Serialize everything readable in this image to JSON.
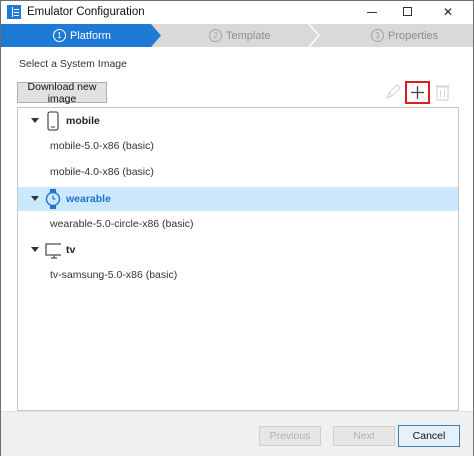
{
  "window": {
    "title": "Emulator Configuration",
    "icons": {
      "app": "list-app-icon",
      "minimize": "minimize-icon",
      "maximize": "maximize-icon",
      "close": "close-icon"
    },
    "close_glyph": "✕"
  },
  "steps": [
    {
      "number": "1",
      "label": "Platform",
      "state": "active"
    },
    {
      "number": "2",
      "label": "Template",
      "state": "inactive"
    },
    {
      "number": "3",
      "label": "Properties",
      "state": "inactive"
    }
  ],
  "colors": {
    "accent": "#1e7ad4",
    "selected_row": "#cce8ff",
    "highlight_border": "#d82020"
  },
  "section_label": "Select a System Image",
  "toolbar": {
    "download_label": "Download new image",
    "icons": [
      "edit-icon",
      "add-icon",
      "delete-icon"
    ]
  },
  "tree": [
    {
      "category": "mobile",
      "icon": "phone-icon",
      "selected": false,
      "items": [
        "mobile-5.0-x86 (basic)",
        "mobile-4.0-x86 (basic)"
      ]
    },
    {
      "category": "wearable",
      "icon": "watch-icon",
      "selected": true,
      "items": [
        "wearable-5.0-circle-x86 (basic)"
      ]
    },
    {
      "category": "tv",
      "icon": "tv-icon",
      "selected": false,
      "items": [
        "tv-samsung-5.0-x86 (basic)"
      ]
    }
  ],
  "footer": {
    "previous_label": "Previous",
    "next_label": "Next",
    "cancel_label": "Cancel"
  }
}
